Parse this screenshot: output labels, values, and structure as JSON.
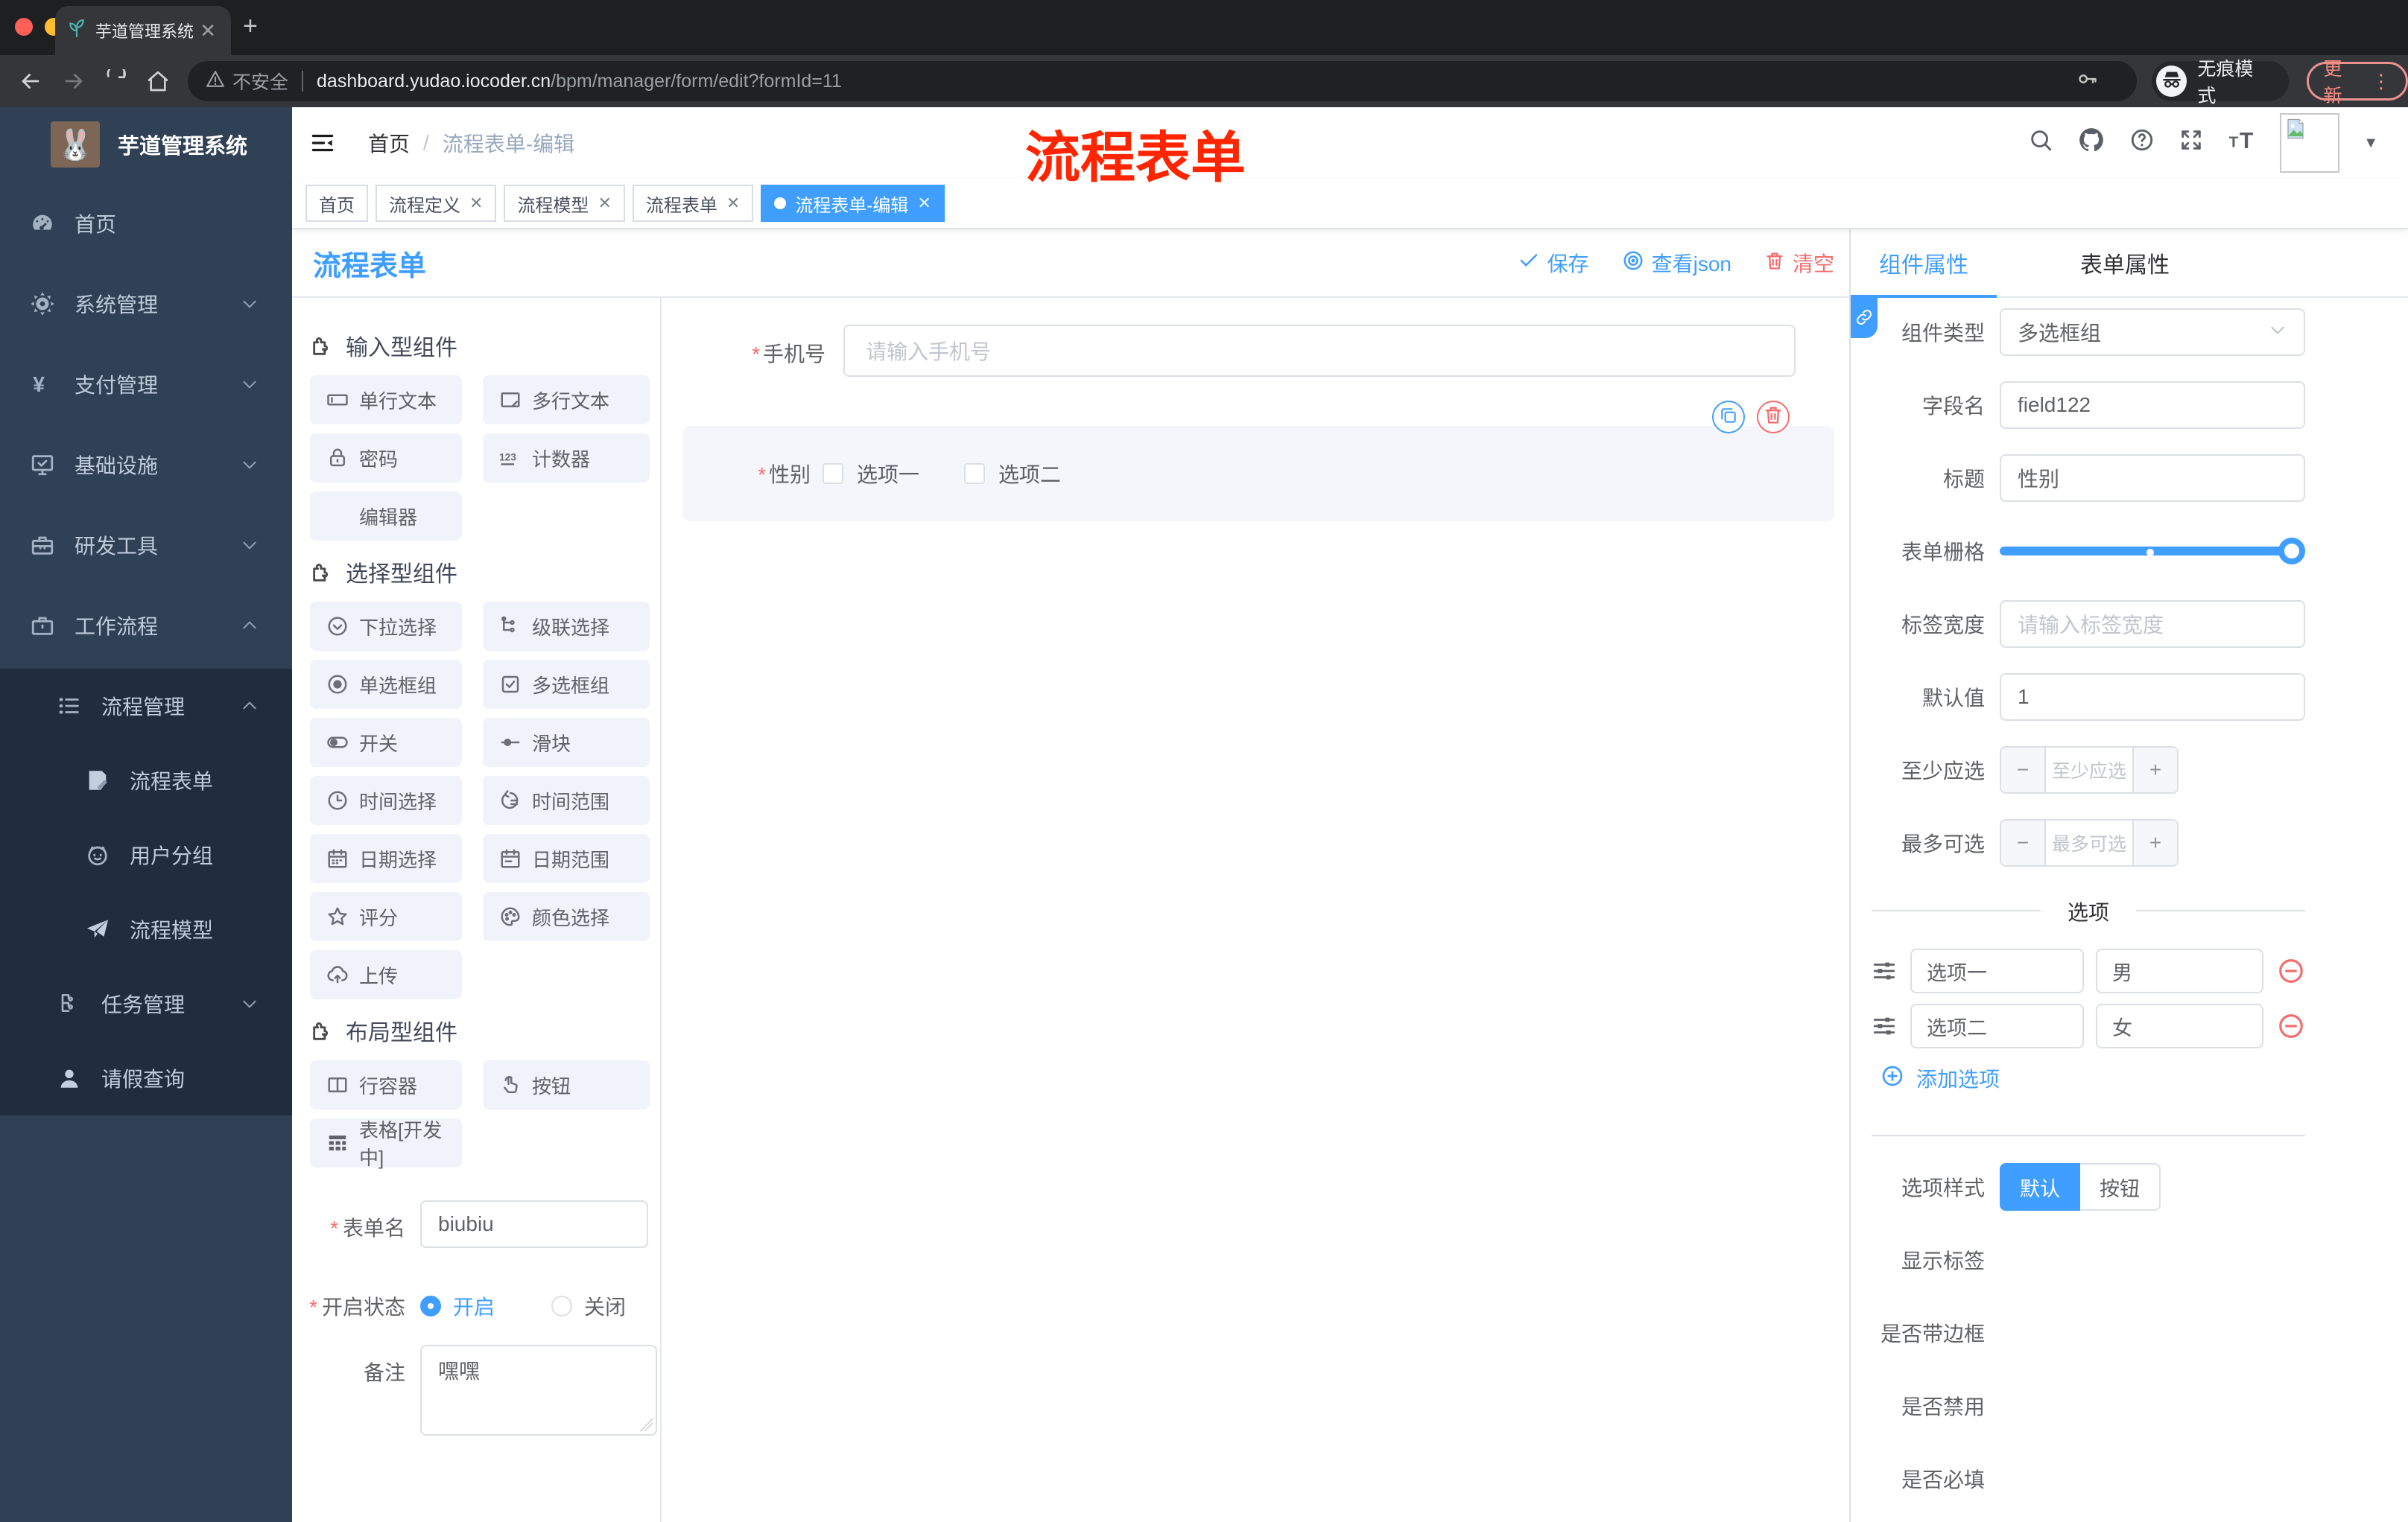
{
  "browser": {
    "tab_title": "芋道管理系统",
    "security_label": "不安全",
    "url_host": "dashboard.yudao.iocoder.cn",
    "url_path": "/bpm/manager/form/edit?formId=11",
    "incognito_label": "无痕模式",
    "update_label": "更新"
  },
  "sidebar": {
    "logo_title": "芋道管理系统",
    "menu": [
      {
        "label": "首页",
        "icon": "dashboard-icon",
        "level": 1,
        "chevron": "",
        "sub": false
      },
      {
        "label": "系统管理",
        "icon": "gear-icon",
        "level": 1,
        "chevron": "down",
        "sub": false
      },
      {
        "label": "支付管理",
        "icon": "yen-icon",
        "level": 1,
        "chevron": "down",
        "sub": false
      },
      {
        "label": "基础设施",
        "icon": "monitor-icon",
        "level": 1,
        "chevron": "down",
        "sub": false
      },
      {
        "label": "研发工具",
        "icon": "toolbox-icon",
        "level": 1,
        "chevron": "down",
        "sub": false
      },
      {
        "label": "工作流程",
        "icon": "briefcase-icon",
        "level": 1,
        "chevron": "up",
        "sub": false
      },
      {
        "label": "流程管理",
        "icon": "flow-list-icon",
        "level": 2,
        "chevron": "up",
        "sub": true
      },
      {
        "label": "流程表单",
        "icon": "doc-edit-icon",
        "level": 3,
        "chevron": "",
        "sub": true
      },
      {
        "label": "用户分组",
        "icon": "face-icon",
        "level": 3,
        "chevron": "",
        "sub": true
      },
      {
        "label": "流程模型",
        "icon": "paper-plane-icon",
        "level": 3,
        "chevron": "",
        "sub": true
      },
      {
        "label": "任务管理",
        "icon": "org-tree-icon",
        "level": 2,
        "chevron": "down",
        "sub": true
      },
      {
        "label": "请假查询",
        "icon": "person-icon",
        "level": 2,
        "chevron": "",
        "sub": true
      }
    ]
  },
  "header": {
    "breadcrumb_home": "首页",
    "breadcrumb_current": "流程表单-编辑",
    "annotation": "流程表单"
  },
  "tags": [
    {
      "label": "首页",
      "closable": false,
      "active": false
    },
    {
      "label": "流程定义",
      "closable": true,
      "active": false
    },
    {
      "label": "流程模型",
      "closable": true,
      "active": false
    },
    {
      "label": "流程表单",
      "closable": true,
      "active": false
    },
    {
      "label": "流程表单-编辑",
      "closable": true,
      "active": true
    }
  ],
  "designer": {
    "panel_title": "流程表单",
    "toolbar": {
      "save": "保存",
      "view_json": "查看json",
      "clear": "清空"
    },
    "sections": [
      {
        "title": "输入型组件",
        "items": [
          {
            "label": "单行文本",
            "icon": "input-icon"
          },
          {
            "label": "多行文本",
            "icon": "textarea-icon"
          },
          {
            "label": "密码",
            "icon": "lock-icon"
          },
          {
            "label": "计数器",
            "icon": "counter-icon"
          },
          {
            "label": "编辑器",
            "icon": "none"
          }
        ]
      },
      {
        "title": "选择型组件",
        "items": [
          {
            "label": "下拉选择",
            "icon": "dropdown-icon"
          },
          {
            "label": "级联选择",
            "icon": "cascade-icon"
          },
          {
            "label": "单选框组",
            "icon": "radio-icon"
          },
          {
            "label": "多选框组",
            "icon": "checkbox-icon"
          },
          {
            "label": "开关",
            "icon": "switch-icon"
          },
          {
            "label": "滑块",
            "icon": "slider-icon"
          },
          {
            "label": "时间选择",
            "icon": "clock-icon"
          },
          {
            "label": "时间范围",
            "icon": "time-range-icon"
          },
          {
            "label": "日期选择",
            "icon": "calendar-icon"
          },
          {
            "label": "日期范围",
            "icon": "date-range-icon"
          },
          {
            "label": "评分",
            "icon": "star-icon"
          },
          {
            "label": "颜色选择",
            "icon": "palette-icon"
          },
          {
            "label": "上传",
            "icon": "upload-icon"
          }
        ]
      },
      {
        "title": "布局型组件",
        "items": [
          {
            "label": "行容器",
            "icon": "row-container-icon"
          },
          {
            "label": "按钮",
            "icon": "button-click-icon"
          },
          {
            "label": "表格[开发中]",
            "icon": "table-grid-icon"
          }
        ]
      }
    ],
    "form": {
      "name_label": "表单名",
      "name_value": "biubiu",
      "status_label": "开启状态",
      "status_on": "开启",
      "status_off": "关闭",
      "remark_label": "备注",
      "remark_value": "嘿嘿"
    },
    "canvas": {
      "phone_label": "手机号",
      "phone_placeholder": "请输入手机号",
      "gender_label": "性别",
      "gender_options": [
        "选项一",
        "选项二"
      ]
    }
  },
  "props": {
    "tab_component": "组件属性",
    "tab_form": "表单属性",
    "component_type_label": "组件类型",
    "component_type_value": "多选框组",
    "field_name_label": "字段名",
    "field_name_value": "field122",
    "title_label": "标题",
    "title_value": "性别",
    "grid_label": "表单栅格",
    "label_width_label": "标签宽度",
    "label_width_placeholder": "请输入标签宽度",
    "default_label": "默认值",
    "default_value": "1",
    "min_label": "至少应选",
    "min_placeholder": "至少应选",
    "max_label": "最多可选",
    "max_placeholder": "最多可选",
    "options_divider": "选项",
    "options": [
      {
        "label": "选项一",
        "value": "男"
      },
      {
        "label": "选项二",
        "value": "女"
      }
    ],
    "add_option": "添加选项",
    "style_label": "选项样式",
    "style_default": "默认",
    "style_button": "按钮",
    "switches": [
      {
        "label": "显示标签",
        "on": true
      },
      {
        "label": "是否带边框",
        "on": false
      },
      {
        "label": "是否禁用",
        "on": false
      },
      {
        "label": "是否必填",
        "on": true
      }
    ]
  },
  "colors": {
    "accent": "#409eff",
    "danger": "#f56c6c",
    "sidebar": "#304156",
    "submenu": "#1f2d3d"
  }
}
